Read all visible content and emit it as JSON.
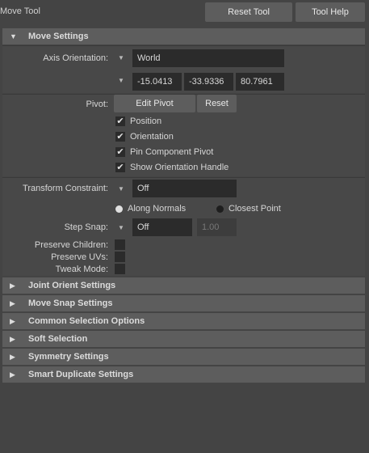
{
  "window": {
    "title": "Move Tool"
  },
  "header": {
    "reset_tool": "Reset Tool",
    "tool_help": "Tool Help"
  },
  "move_settings": {
    "title": "Move Settings",
    "axis_orientation_label": "Axis Orientation:",
    "axis_orientation_value": "World",
    "coords": [
      "-15.0413",
      "-33.9336",
      "80.7961"
    ],
    "pivot_label": "Pivot:",
    "edit_pivot": "Edit Pivot",
    "reset": "Reset",
    "pivot_options": [
      {
        "label": "Position",
        "checked": true
      },
      {
        "label": "Orientation",
        "checked": true
      },
      {
        "label": "Pin Component Pivot",
        "checked": true
      },
      {
        "label": "Show Orientation Handle",
        "checked": true
      }
    ],
    "transform_constraint_label": "Transform Constraint:",
    "transform_constraint_value": "Off",
    "along_normals": "Along Normals",
    "closest_point": "Closest Point",
    "step_snap_label": "Step Snap:",
    "step_snap_value": "Off",
    "step_snap_amount": "1.00",
    "preserve_children": "Preserve Children:",
    "preserve_uvs": "Preserve UVs:",
    "tweak_mode": "Tweak Mode:"
  },
  "collapsed_sections": [
    "Joint Orient Settings",
    "Move Snap Settings",
    "Common Selection Options",
    "Soft Selection",
    "Symmetry Settings",
    "Smart Duplicate Settings"
  ],
  "colors": {
    "background": "#444444",
    "header": "#5d5d5d",
    "field": "#2b2b2b"
  }
}
